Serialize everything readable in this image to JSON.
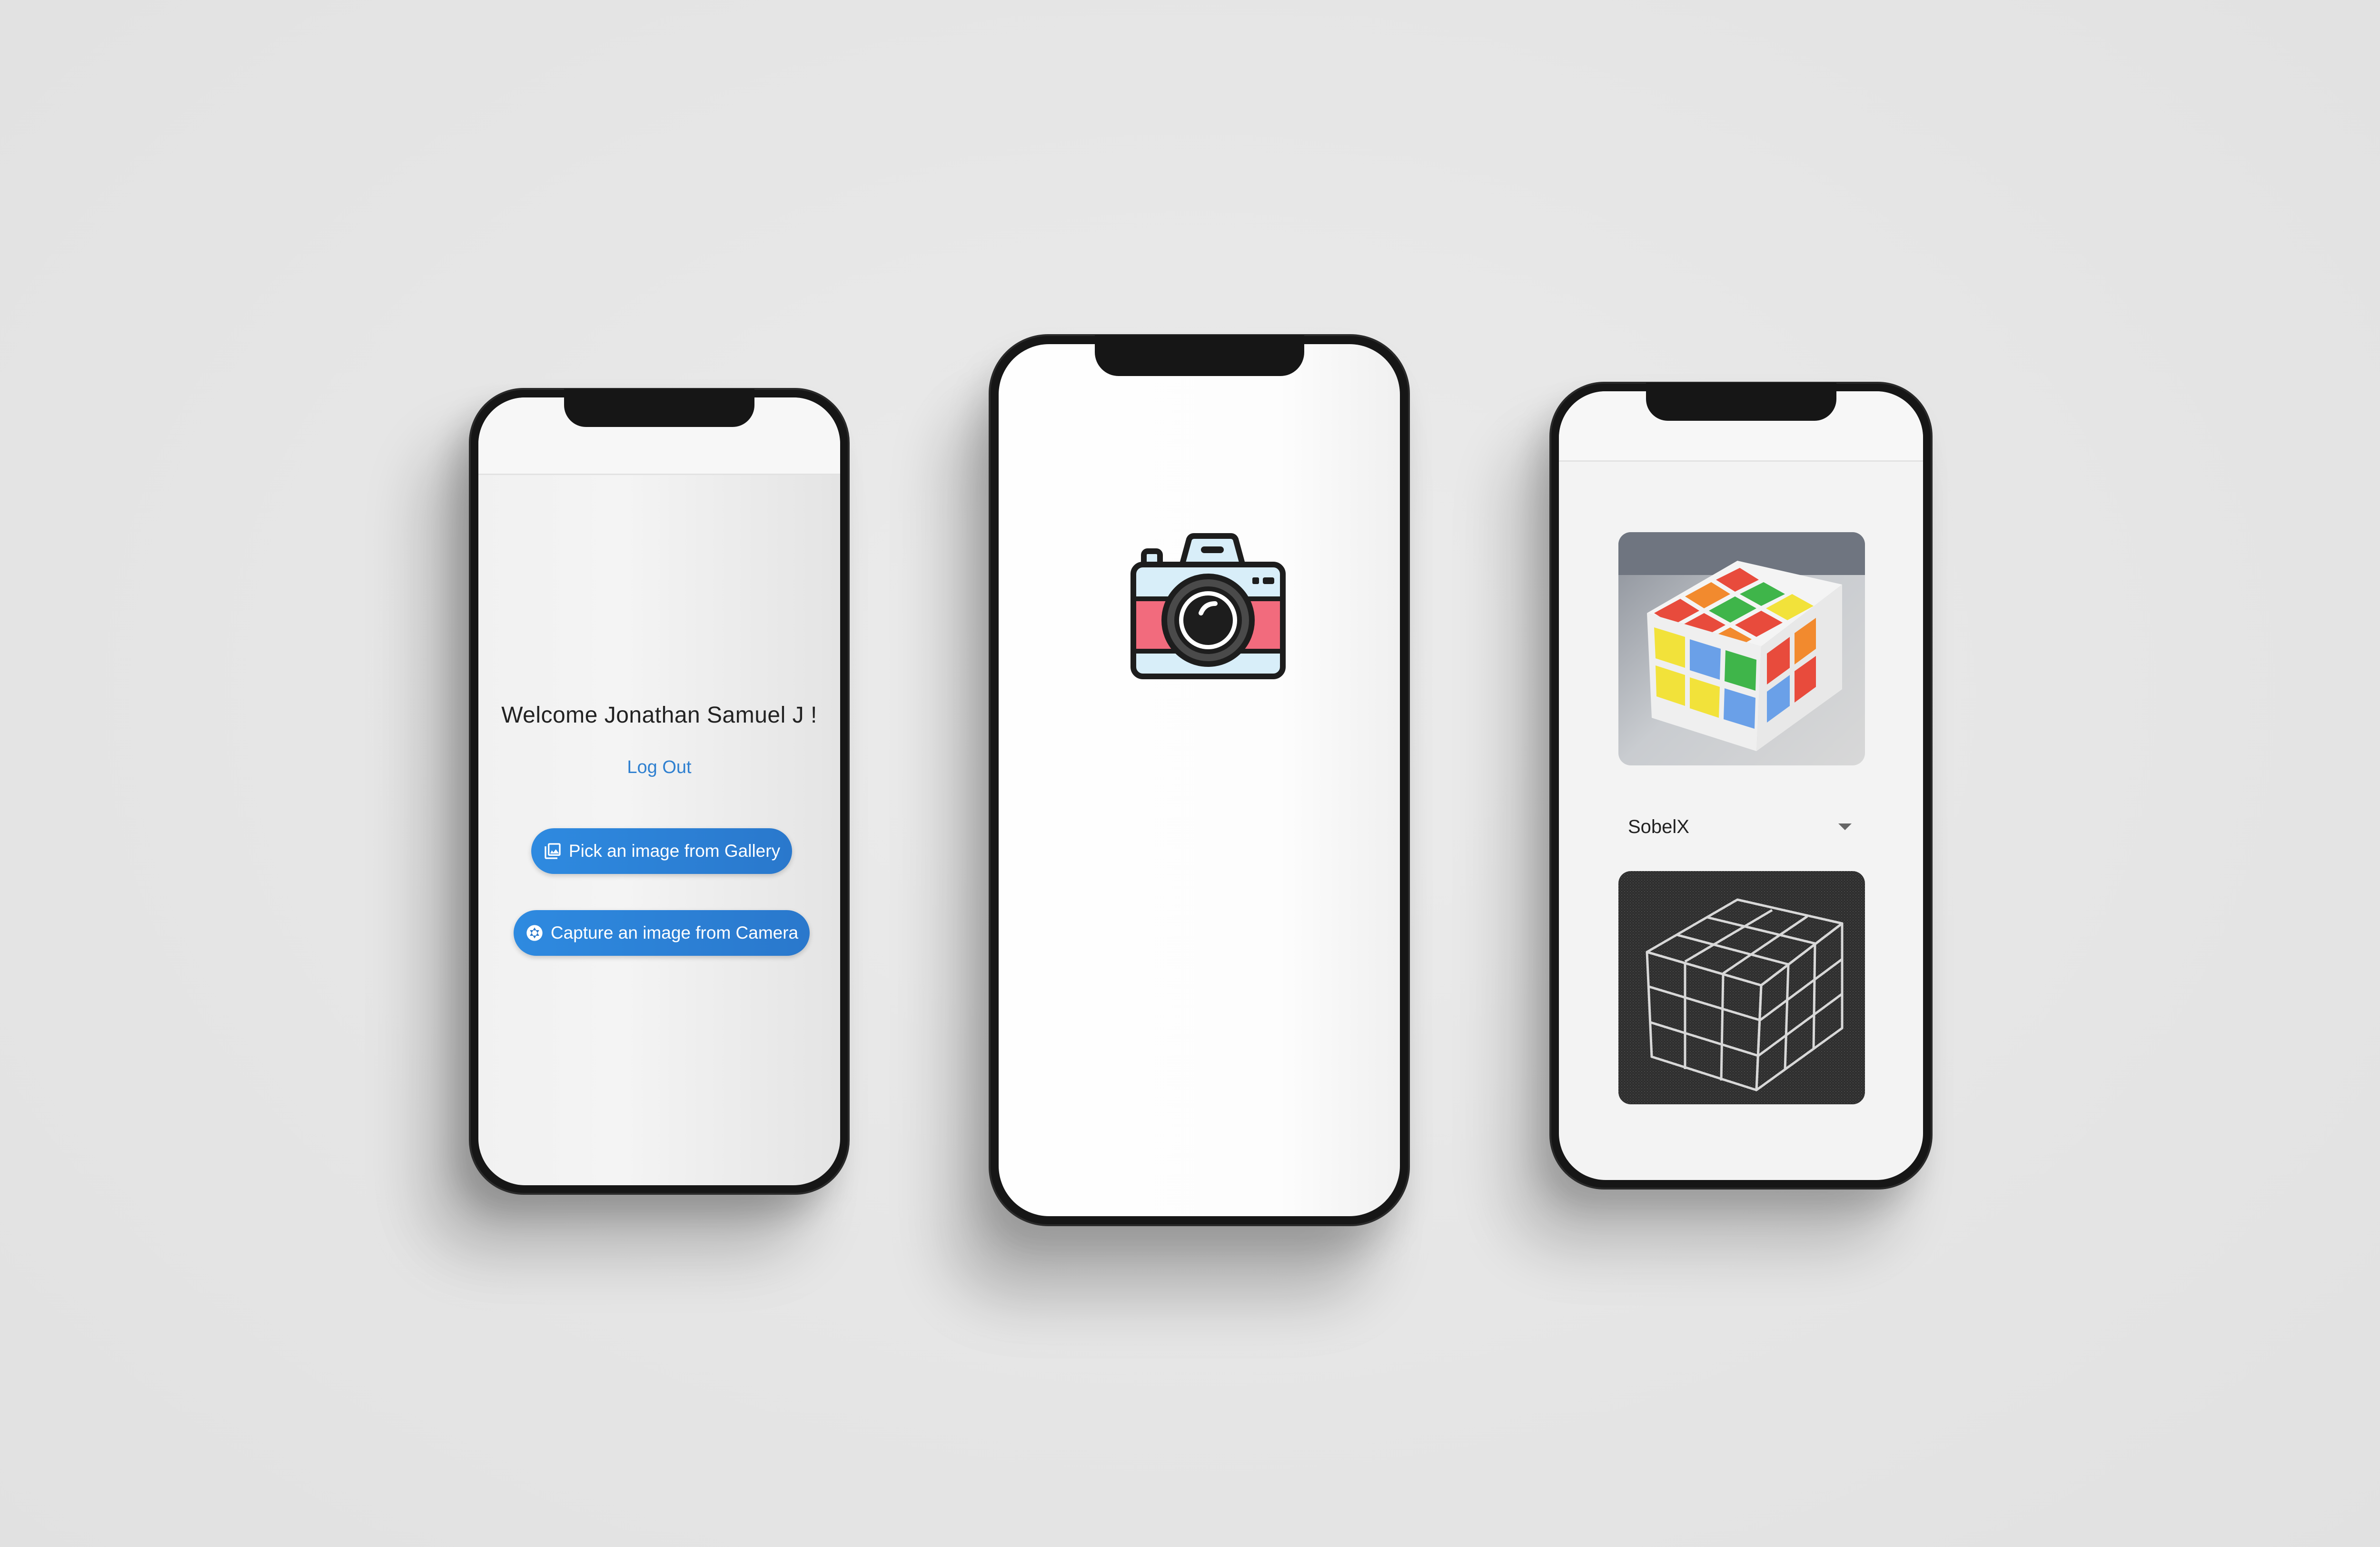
{
  "left_phone": {
    "welcome_text": "Welcome Jonathan Samuel J !",
    "logout_label": "Log Out",
    "gallery_button": {
      "label": "Pick an image from Gallery",
      "icon": "photo-library-icon"
    },
    "camera_button": {
      "label": "Capture an image from Camera",
      "icon": "camera-aperture-icon"
    },
    "accent_color": "#2f80d0"
  },
  "center_phone": {
    "logo_icon": "camera-icon",
    "logo_colors": {
      "body_top": "#d8eef9",
      "band": "#f26b7d",
      "outline": "#1d1d1d"
    }
  },
  "right_phone": {
    "original_image": {
      "icon": "rubiks-cube-photo"
    },
    "filter_select": {
      "selected": "SobelX",
      "icon": "caret-down-icon"
    },
    "filtered_image": {
      "icon": "rubiks-cube-sobel-edges"
    }
  }
}
